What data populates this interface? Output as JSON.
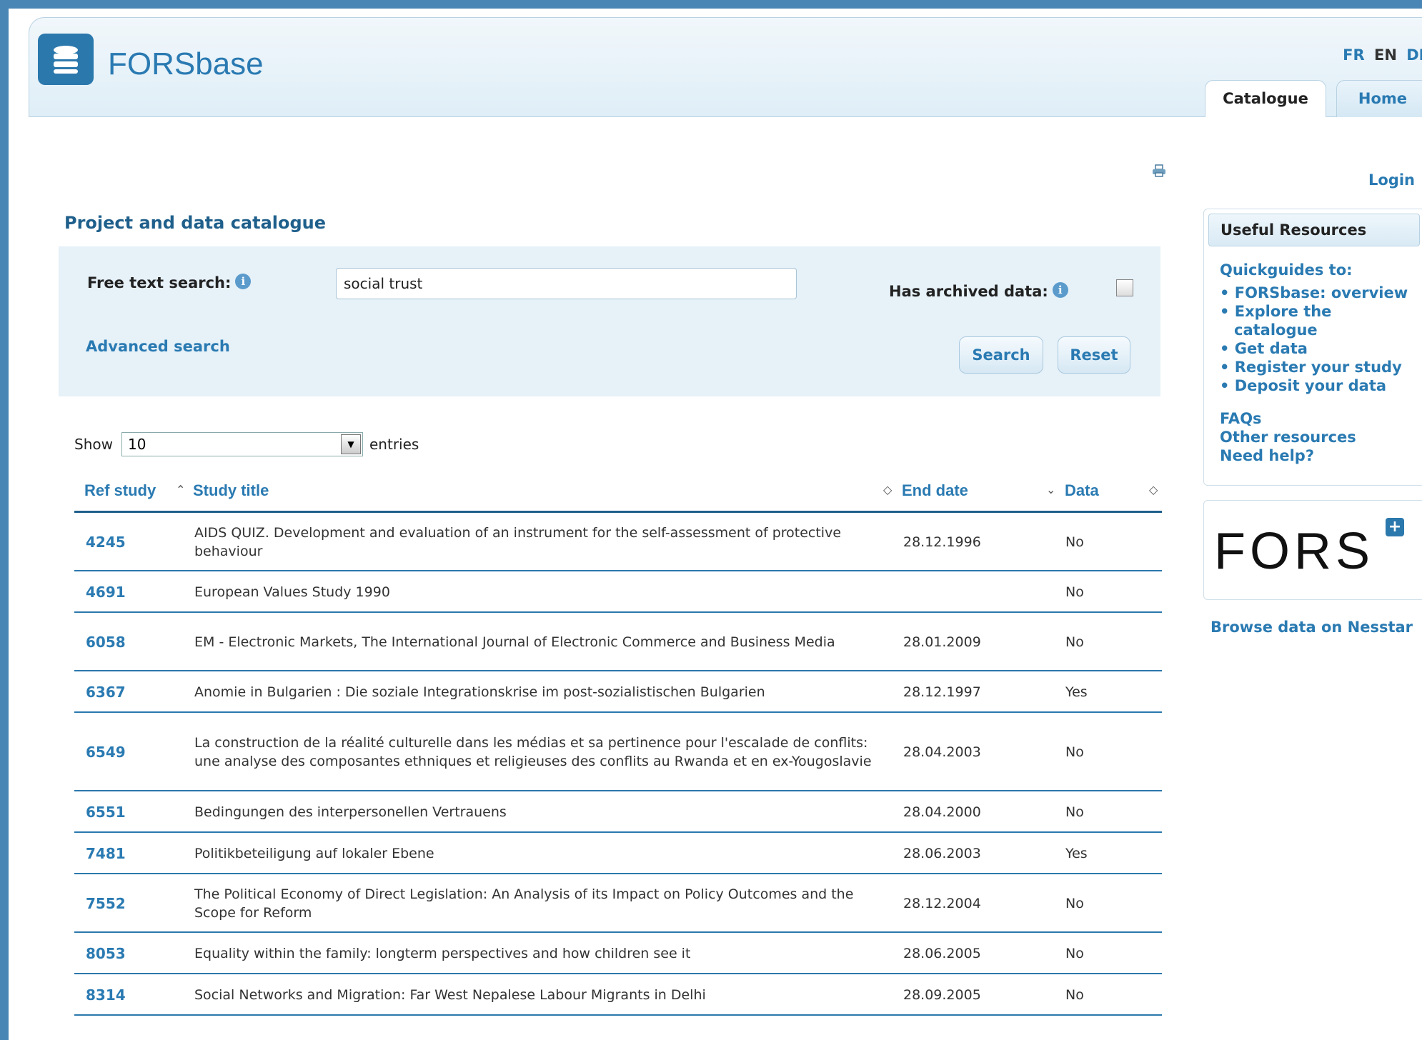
{
  "brand": {
    "name": "FORSbase"
  },
  "languages": [
    {
      "code": "FR"
    },
    {
      "code": "EN"
    },
    {
      "code": "DE"
    }
  ],
  "tabs": {
    "catalogue": "Catalogue",
    "home": "Home"
  },
  "login": "Login",
  "main": {
    "title": "Project and data catalogue",
    "free_text_label": "Free text search:",
    "search_value": "social trust",
    "has_archived_label": "Has archived data:",
    "advanced_search": "Advanced search",
    "search_button": "Search",
    "reset_button": "Reset",
    "show_label": "Show",
    "show_value": "10",
    "entries_label": "entries"
  },
  "table": {
    "headers": {
      "ref": "Ref study",
      "title": "Study title",
      "end_date": "End date",
      "data": "Data"
    },
    "rows": [
      {
        "ref": "4245",
        "title": "AIDS QUIZ. Development and evaluation of an instrument for the self-assessment of protective behaviour",
        "end_date": "28.12.1996",
        "data": "No"
      },
      {
        "ref": "4691",
        "title": "European Values Study 1990",
        "end_date": "",
        "data": "No"
      },
      {
        "ref": "6058",
        "title": "EM - Electronic Markets, The International Journal of Electronic Commerce and Business Media",
        "end_date": "28.01.2009",
        "data": "No"
      },
      {
        "ref": "6367",
        "title": "Anomie in Bulgarien : Die soziale Integrationskrise im post-sozialistischen Bulgarien",
        "end_date": "28.12.1997",
        "data": "Yes"
      },
      {
        "ref": "6549",
        "title": "La construction de la réalité culturelle dans les médias et sa pertinence pour l'escalade de conflits: une analyse des composantes ethniques et religieuses des conflits au Rwanda et en ex-Yougoslavie",
        "end_date": "28.04.2003",
        "data": "No"
      },
      {
        "ref": "6551",
        "title": "Bedingungen des interpersonellen Vertrauens",
        "end_date": "28.04.2000",
        "data": "No"
      },
      {
        "ref": "7481",
        "title": "Politikbeteiligung auf lokaler Ebene",
        "end_date": "28.06.2003",
        "data": "Yes"
      },
      {
        "ref": "7552",
        "title": "The Political Economy of Direct Legislation: An Analysis of its Impact on Policy Outcomes and the Scope for Reform",
        "end_date": "28.12.2004",
        "data": "No"
      },
      {
        "ref": "8053",
        "title": "Equality within the family: longterm perspectives and how children see it",
        "end_date": "28.06.2005",
        "data": "No"
      },
      {
        "ref": "8314",
        "title": "Social Networks and Migration: Far West Nepalese Labour Migrants in Delhi",
        "end_date": "28.09.2005",
        "data": "No"
      }
    ]
  },
  "sidebar": {
    "title": "Useful Resources",
    "quickguides": "Quickguides to:",
    "guides": [
      "• FORSbase: overview",
      "• Explore the",
      "catalogue",
      "• Get data",
      "• Register your study",
      "• Deposit your data"
    ],
    "faqs": "FAQs",
    "other": "Other resources",
    "help": "Need help?",
    "fors_logo": "FORS",
    "nesstar": "Browse data on Nesstar"
  },
  "colors": {
    "accent": "#2a7ab2",
    "frame": "#4a86b5",
    "header_text": "#1f5f8b"
  }
}
